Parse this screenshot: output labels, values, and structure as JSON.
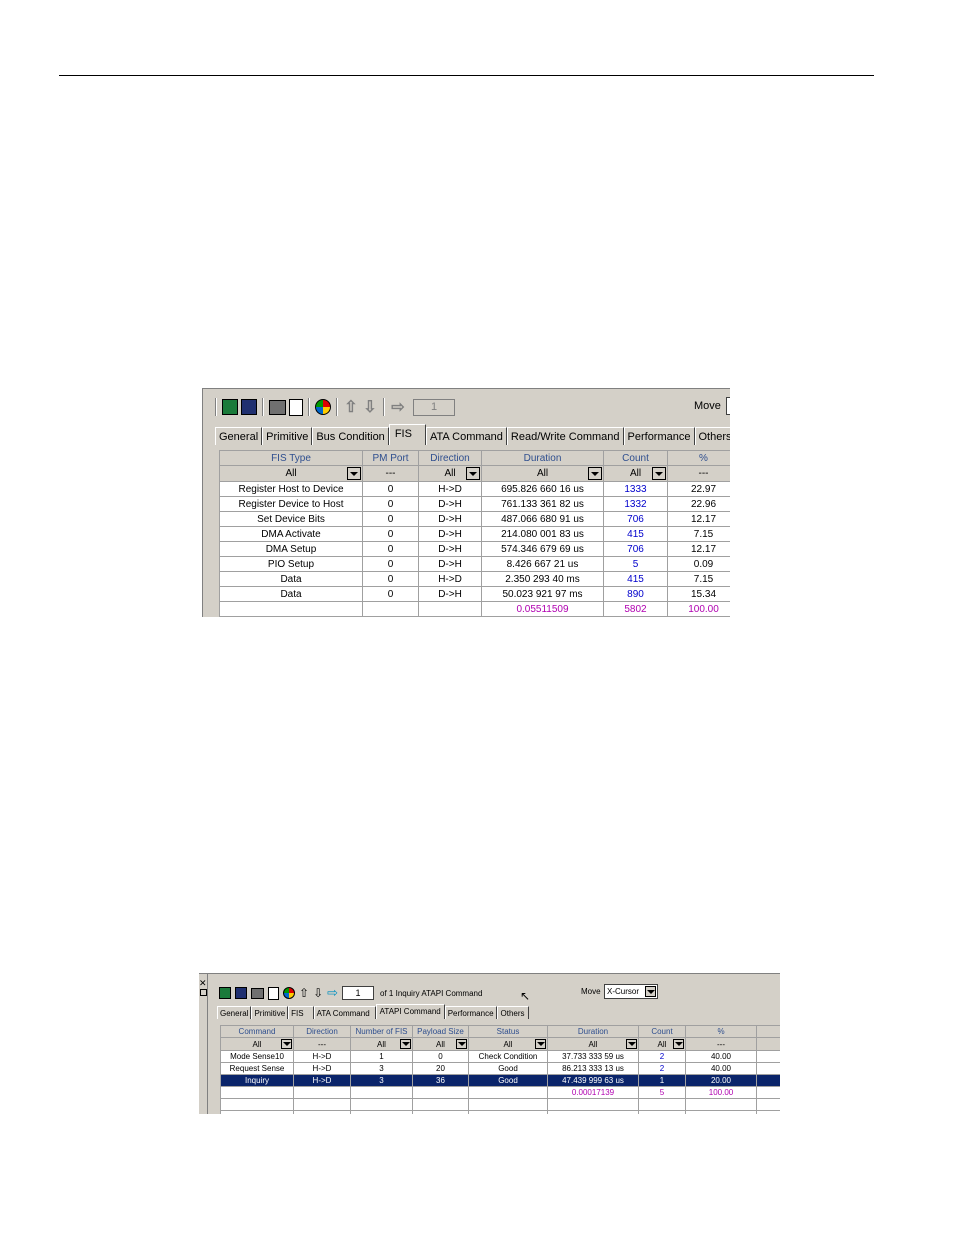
{
  "screenshot1": {
    "move_label": "Move",
    "page_value": "1",
    "tabs": [
      "General",
      "Primitive",
      "Bus Condition",
      "FIS",
      "ATA Command",
      "Read/Write Command",
      "Performance",
      "Others"
    ],
    "active_tab": "FIS",
    "columns": [
      "FIS Type",
      "PM Port",
      "Direction",
      "Duration",
      "Count",
      "%"
    ],
    "filters": [
      "All",
      "---",
      "All",
      "All",
      "All",
      "---"
    ],
    "rows": [
      [
        "Register Host to Device",
        "0",
        "H->D",
        "695.826 660 16  us",
        "1333",
        "22.97"
      ],
      [
        "Register Device to Host",
        "0",
        "D->H",
        "761.133 361 82  us",
        "1332",
        "22.96"
      ],
      [
        "Set Device Bits",
        "0",
        "D->H",
        "487.066 680 91  us",
        "706",
        "12.17"
      ],
      [
        "DMA Activate",
        "0",
        "D->H",
        "214.080 001 83  us",
        "415",
        "7.15"
      ],
      [
        "DMA Setup",
        "0",
        "D->H",
        "574.346 679 69  us",
        "706",
        "12.17"
      ],
      [
        "PIO Setup",
        "0",
        "D->H",
        "8.426 667 21  us",
        "5",
        "0.09"
      ],
      [
        "Data",
        "0",
        "H->D",
        "2.350 293 40  ms",
        "415",
        "7.15"
      ],
      [
        "Data",
        "0",
        "D->H",
        "50.023 921 97  ms",
        "890",
        "15.34"
      ]
    ],
    "totals": [
      "",
      "",
      "",
      "0.05511509",
      "5802",
      "100.00"
    ]
  },
  "screenshot2": {
    "page_value": "1",
    "page_info": "of 1  Inquiry ATAPI Command",
    "move_label": "Move",
    "move_select": "X-Cursor",
    "tabs": [
      "General",
      "Primitive",
      "FIS",
      "ATA Command",
      "ATAPI Command",
      "Performance",
      "Others"
    ],
    "active_tab": "ATAPI Command",
    "columns": [
      "Command",
      "Direction",
      "Number of FIS",
      "Payload Size",
      "Status",
      "Duration",
      "Count",
      "%"
    ],
    "filters": [
      "All",
      "---",
      "All",
      "All",
      "All",
      "All",
      "All",
      "---"
    ],
    "rows": [
      [
        "Mode Sense10",
        "H->D",
        "1",
        "0",
        "Check Condition",
        "37.733 333 59  us",
        "2",
        "40.00"
      ],
      [
        "Request Sense",
        "H->D",
        "3",
        "20",
        "Good",
        "86.213 333 13  us",
        "2",
        "40.00"
      ],
      [
        "Inquiry",
        "H->D",
        "3",
        "36",
        "Good",
        "47.439 999 63  us",
        "1",
        "20.00"
      ]
    ],
    "totals": [
      "",
      "",
      "",
      "",
      "",
      "0.00017139",
      "5",
      "100.00"
    ]
  },
  "colors": {
    "window_bg": "#d4d0c8",
    "header_text": "#2f4f8f",
    "count_text": "#0000cc",
    "total_text": "#b000b0",
    "selection": "#0a246a"
  }
}
